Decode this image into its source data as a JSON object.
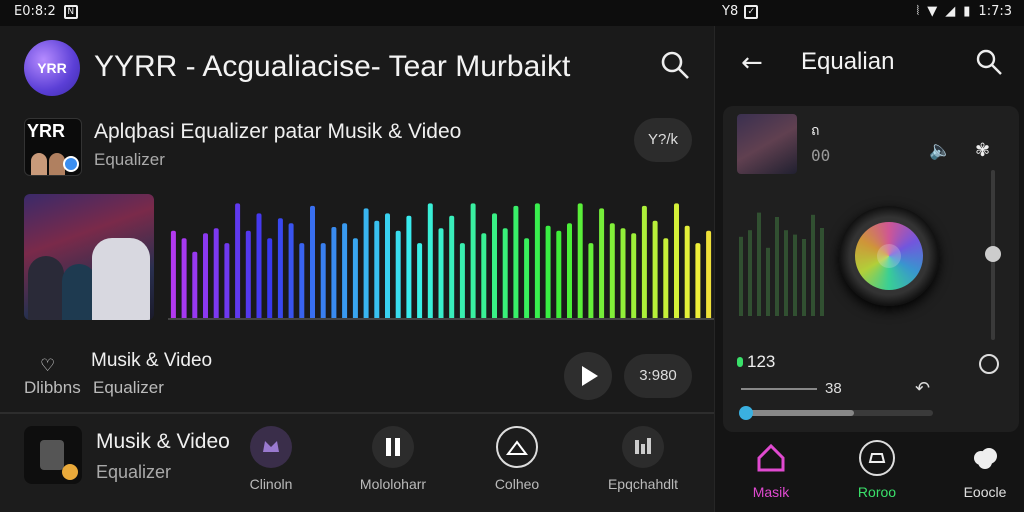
{
  "status_bar": {
    "time_left": "E0:8:2",
    "mid_text": "Y8",
    "time_right": "1:7:3"
  },
  "header": {
    "logo_text": "YRR",
    "title": "YYRR - Acgualiacise- Tear Murbaikt"
  },
  "app_info": {
    "icon_text": "YRR",
    "name": "Aplqbasi Equalizer patar Musik & Video",
    "subtitle": "Equalizer",
    "pill": "Y?/k"
  },
  "visualizer": {
    "bar_levels": [
      0.72,
      0.66,
      0.55,
      0.7,
      0.74,
      0.62,
      0.94,
      0.72,
      0.86,
      0.66,
      0.82,
      0.78,
      0.62,
      0.92,
      0.62,
      0.75,
      0.78,
      0.66,
      0.9,
      0.8,
      0.86,
      0.72,
      0.84,
      0.62,
      0.94,
      0.74,
      0.84,
      0.62,
      0.94,
      0.7,
      0.86,
      0.74,
      0.92,
      0.66,
      0.94,
      0.76,
      0.72,
      0.78,
      0.94,
      0.62,
      0.9,
      0.78,
      0.74,
      0.7,
      0.92,
      0.8,
      0.66,
      0.94,
      0.76,
      0.62,
      0.72
    ]
  },
  "controls": {
    "line1": "Musik & Video",
    "line2": "Dlibbns",
    "line3": "Equalizer",
    "time": "3:980"
  },
  "bottom": {
    "title": "Musik & Video",
    "subtitle": "Equalizer",
    "actions": [
      {
        "label": "Clinoln"
      },
      {
        "label": "Mololoharr"
      },
      {
        "label": "Colheo"
      },
      {
        "label": "Epqchahdlt"
      }
    ]
  },
  "side_panel": {
    "title": "Equalian",
    "track_title": "ถ",
    "track_code": "00",
    "level_value": "123",
    "slider_value": "38",
    "progress": 0.58,
    "tabs": [
      {
        "label": "Masik",
        "color": "#e04ad0"
      },
      {
        "label": "Roroo",
        "color": "#3ae06a"
      },
      {
        "label": "Eoocle",
        "color": "#e0e0e0"
      }
    ]
  }
}
